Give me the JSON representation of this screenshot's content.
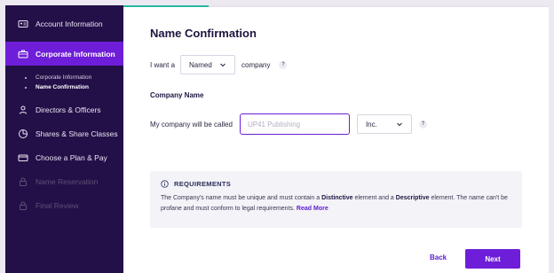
{
  "sidebar": {
    "items": [
      {
        "label": "Account Information",
        "icon": "id-card-icon",
        "state": "normal"
      },
      {
        "label": "Corporate Information",
        "icon": "briefcase-icon",
        "state": "active"
      },
      {
        "label": "Directors & Officers",
        "icon": "person-icon",
        "state": "normal"
      },
      {
        "label": "Shares & Share Classes",
        "icon": "pie-chart-icon",
        "state": "normal"
      },
      {
        "label": "Choose a Plan & Pay",
        "icon": "credit-card-icon",
        "state": "normal"
      },
      {
        "label": "Name Reservation",
        "icon": "lock-icon",
        "state": "disabled"
      },
      {
        "label": "Final Review",
        "icon": "lock-icon",
        "state": "disabled"
      }
    ],
    "sub_items": [
      {
        "label": "Corporate Information",
        "current": false
      },
      {
        "label": "Name Confirmation",
        "current": true
      }
    ]
  },
  "progress": 0.2,
  "page": {
    "title": "Name Confirmation",
    "prefix": "I want a",
    "name_type": "Named",
    "suffix": "company",
    "section_label": "Company Name",
    "company_called": "My company will be called",
    "name_placeholder": "UP41 Publishing",
    "designation": "Inc."
  },
  "requirements": {
    "heading": "REQUIREMENTS",
    "text_1": "The Company's name must be unique and must contain a ",
    "bold_1": "Distinctive",
    "text_2": " element and a ",
    "bold_2": "Descriptive",
    "text_3": " element. The name can't be profane and must conform to legal requirements. ",
    "read_more": "Read More"
  },
  "buttons": {
    "back": "Back",
    "next": "Next"
  },
  "colors": {
    "sidebar_bg": "#231048",
    "accent": "#6e1ed8",
    "progress": "#2bb6a0"
  }
}
